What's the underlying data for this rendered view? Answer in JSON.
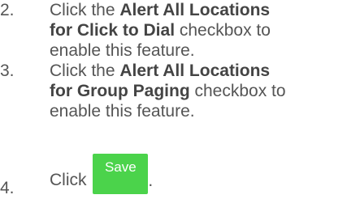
{
  "steps": [
    {
      "number": "2.",
      "pre": "Click the ",
      "bold_line1": "Alert All Locations",
      "bold_line2": "for Click to Dial",
      "post_line2": " checkbox to",
      "line3": "enable this feature."
    },
    {
      "number": "3.",
      "pre": "Click the ",
      "bold_line1": "Alert All Locations",
      "bold_line2": "for Group Paging",
      "post_line2": " checkbox to",
      "line3": "enable this feature."
    },
    {
      "number": "4.",
      "pre": "Click ",
      "button_label": "Save",
      "post": ".",
      "button_color": "#4bd34b"
    }
  ]
}
